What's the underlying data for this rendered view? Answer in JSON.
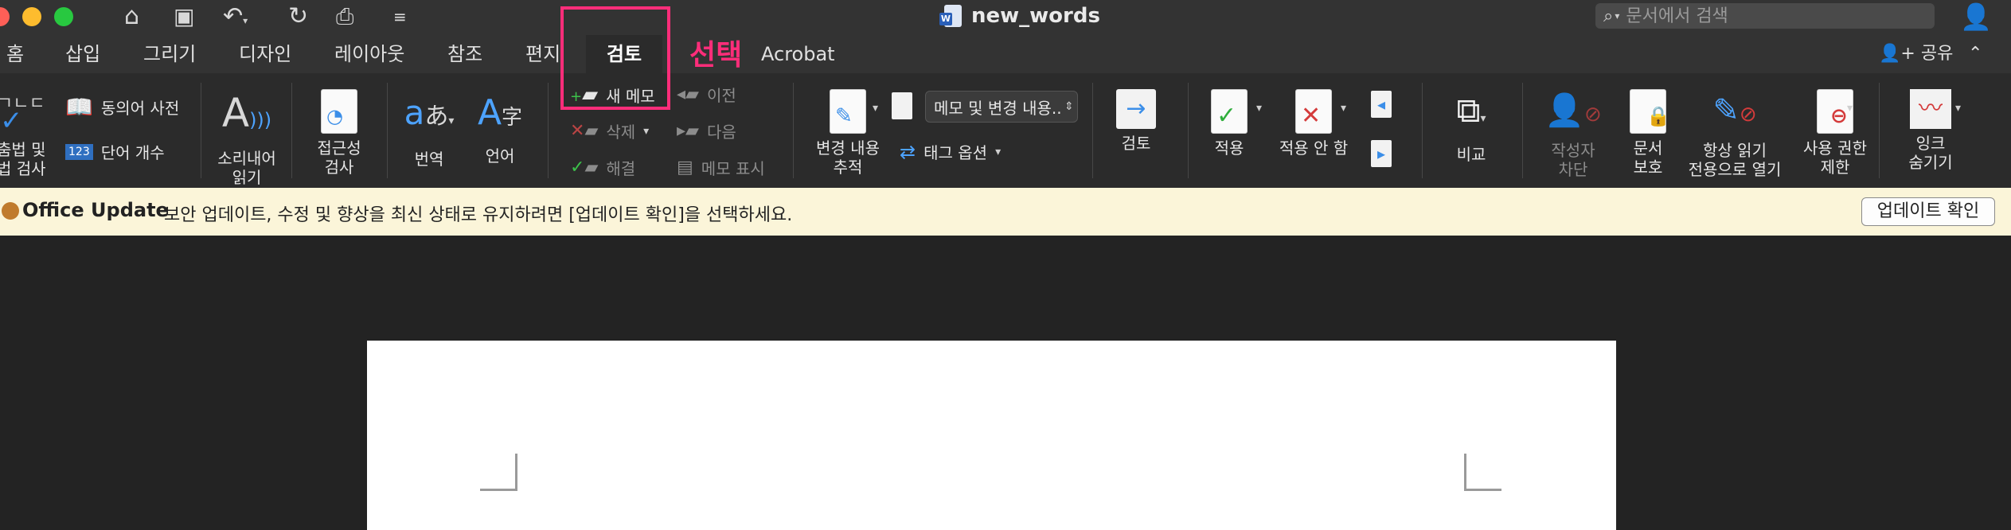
{
  "window": {
    "title": "new_words",
    "search_placeholder": "문서에서 검색"
  },
  "tabs": [
    {
      "label": "홈"
    },
    {
      "label": "삽입"
    },
    {
      "label": "그리기"
    },
    {
      "label": "디자인"
    },
    {
      "label": "레이아웃"
    },
    {
      "label": "참조"
    },
    {
      "label": "편지"
    },
    {
      "label": "검토"
    },
    {
      "label": "Acrobat"
    }
  ],
  "share_label": "공유",
  "annotation": "선택",
  "ribbon": {
    "spelling": "춤법 및\n법 검사",
    "thesaurus": "동의어 사전",
    "wordcount": "단어 개수",
    "readaloud": "소리내어\n읽기",
    "accessibility": "접근성\n검사",
    "translate": "번역",
    "language": "언어",
    "new_comment": "새 메모",
    "delete": "삭제",
    "resolve": "해결",
    "previous": "이전",
    "next": "다음",
    "show_comments": "메모 표시",
    "track_changes": "변경 내용\n추적",
    "markup_dropdown": "메모 및 변경 내용...",
    "tag_options": "태그 옵션",
    "review": "검토",
    "accept": "적용",
    "reject": "적용 안 함",
    "compare": "비교",
    "block_authors": "작성자\n차단",
    "protect_document": "문서\n보호",
    "always_open_readonly": "항상 읽기\n전용으로 열기",
    "restrict_permission": "사용 권한\n제한",
    "hide_ink": "잉크\n숨기기"
  },
  "update_bar": {
    "name": "Office Update",
    "message": "보안 업데이트, 수정 및 향상을 최신 상태로 유지하려면 [업데이트 확인]을 선택하세요.",
    "button": "업데이트 확인"
  }
}
